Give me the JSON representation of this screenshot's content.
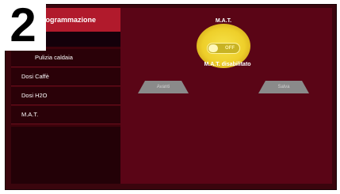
{
  "step_number": "2",
  "sidebar": {
    "header": "Programmazione",
    "items": [
      {
        "label": "Pulizia caldaia"
      },
      {
        "label": "Dosi Caffè"
      },
      {
        "label": "Dosi H2O"
      },
      {
        "label": "M.A.T."
      }
    ]
  },
  "main": {
    "title": "M.A.T.",
    "toggle": {
      "label": "OFF",
      "state": "off"
    },
    "status": "M.A.T. disabilitato",
    "left_button": {
      "label": "Avanti"
    },
    "right_button": {
      "label": "Salva"
    }
  },
  "colors": {
    "accent_red": "#b11a2c",
    "highlight_yellow": "#f0d02f",
    "background": "#520412"
  }
}
